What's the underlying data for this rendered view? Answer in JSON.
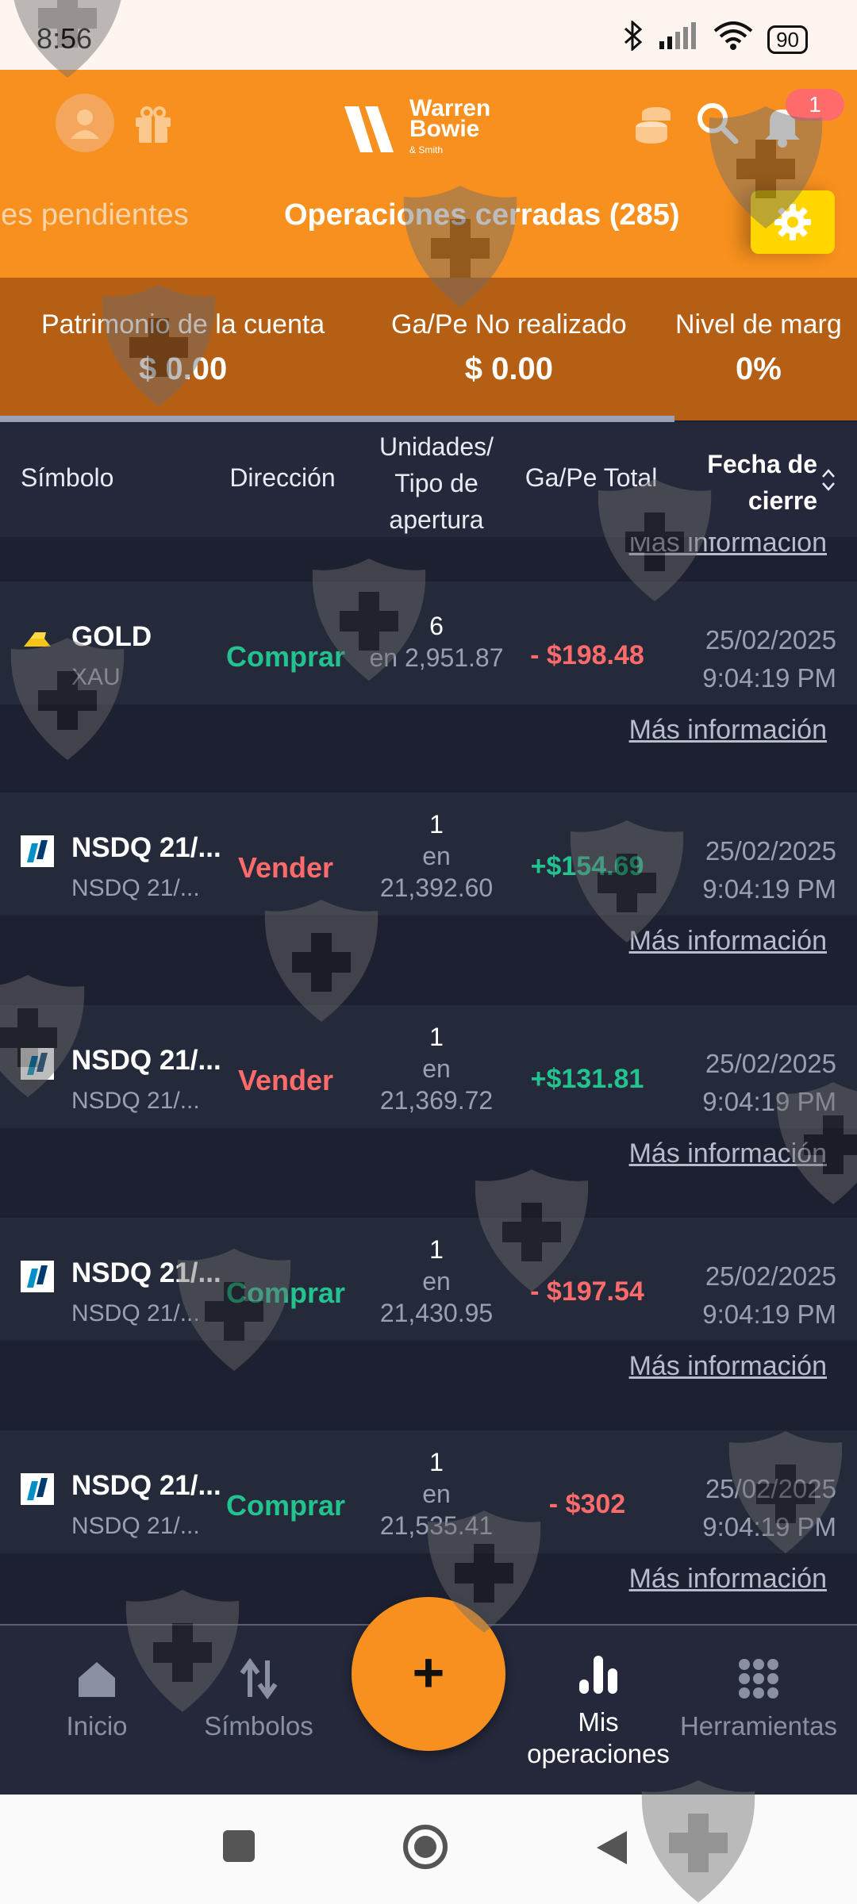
{
  "status_bar": {
    "time": "8:56",
    "battery": "90"
  },
  "header": {
    "brand_line1": "Warren",
    "brand_line2": "Bowie",
    "brand_line3": "& Smith",
    "notification_count": "1",
    "tabs": [
      {
        "label": "nes pendientes",
        "active": false
      },
      {
        "label": "Operaciones cerradas (285)",
        "active": true
      }
    ]
  },
  "summary": [
    {
      "label": "Patrimonio de la cuenta",
      "value": "$ 0.00"
    },
    {
      "label": "Ga/Pe No realizado",
      "value": "$ 0.00"
    },
    {
      "label": "Nivel de marg",
      "value": "0%"
    }
  ],
  "table": {
    "headers": {
      "symbol": "Símbolo",
      "direction": "Dirección",
      "units_l1": "Unidades/",
      "units_l2": "Tipo de",
      "units_l3": "apertura",
      "pl": "Ga/Pe Total",
      "date_l1": "Fecha de",
      "date_l2": "cierre"
    },
    "more_info": "Más información",
    "rows": [
      {
        "symbol": "GOLD",
        "sub": "XAU",
        "direction": "Comprar",
        "units": "6",
        "open_l1": "en 2,951.87",
        "open_l2": "",
        "pl": "- $198.48",
        "date": "25/02/2025",
        "time": "9:04:19 PM",
        "more": "Más información"
      },
      {
        "symbol": "NSDQ 21/...",
        "sub": "NSDQ 21/...",
        "direction": "Vender",
        "units": "1",
        "open_l1": "en",
        "open_l2": "21,392.60",
        "pl": "+$154.69",
        "date": "25/02/2025",
        "time": "9:04:19 PM",
        "more": "Más información"
      },
      {
        "symbol": "NSDQ 21/...",
        "sub": "NSDQ 21/...",
        "direction": "Vender",
        "units": "1",
        "open_l1": "en",
        "open_l2": "21,369.72",
        "pl": "+$131.81",
        "date": "25/02/2025",
        "time": "9:04:19 PM",
        "more": "Más información"
      },
      {
        "symbol": "NSDQ 21/...",
        "sub": "NSDQ 21/...",
        "direction": "Comprar",
        "units": "1",
        "open_l1": "en",
        "open_l2": "21,430.95",
        "pl": "- $197.54",
        "date": "25/02/2025",
        "time": "9:04:19 PM",
        "more": "Más información"
      },
      {
        "symbol": "NSDQ 21/...",
        "sub": "NSDQ 21/...",
        "direction": "Comprar",
        "units": "1",
        "open_l1": "en",
        "open_l2": "21,535.41",
        "pl": "- $302",
        "date": "25/02/2025",
        "time": "9:04:19 PM",
        "more": "Más información"
      }
    ]
  },
  "bottom_nav": {
    "home": "Inicio",
    "symbols": "Símbolos",
    "fab": "+",
    "my_ops_l1": "Mis",
    "my_ops_l2": "operaciones",
    "tools": "Herramientas"
  },
  "colors": {
    "accent": "#f7901e",
    "buy": "#22c38e",
    "sell": "#ff6b6b",
    "settings": "#ffd600"
  }
}
